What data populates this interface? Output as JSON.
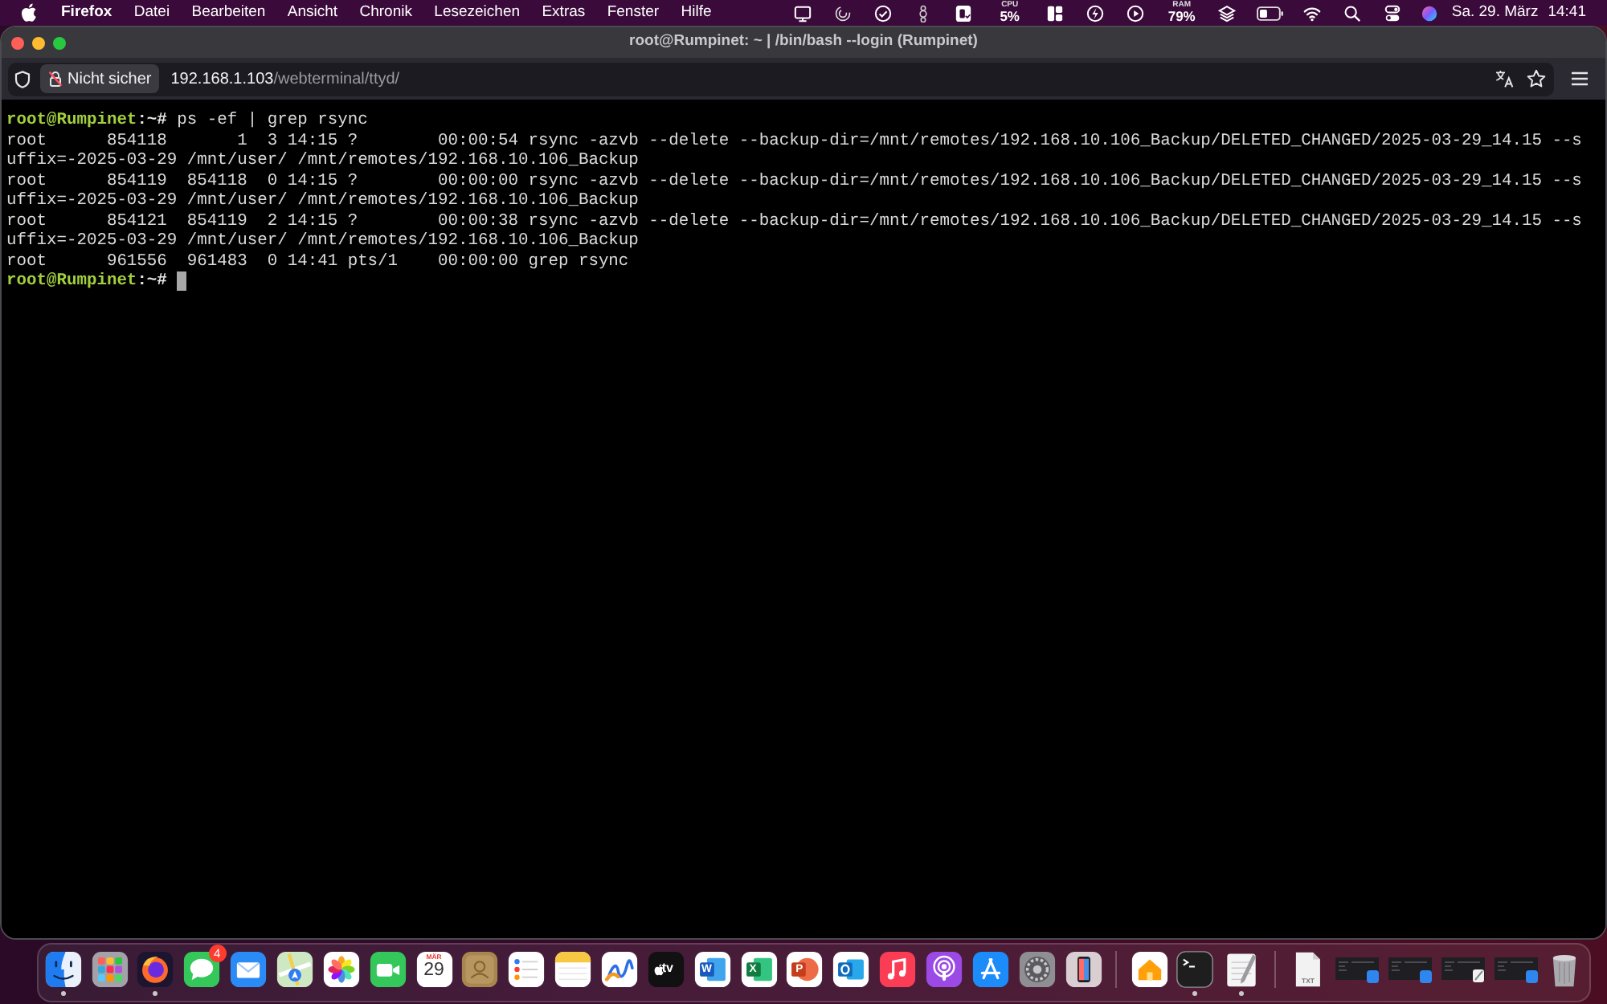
{
  "menubar": {
    "app": "Firefox",
    "menus": [
      "Datei",
      "Bearbeiten",
      "Ansicht",
      "Chronik",
      "Lesezeichen",
      "Extras",
      "Fenster",
      "Hilfe"
    ],
    "status_items": [
      {
        "kind": "screen"
      },
      {
        "kind": "spiral"
      },
      {
        "kind": "check"
      },
      {
        "kind": "figure"
      },
      {
        "kind": "tile"
      },
      {
        "kind": "meter",
        "label": "CPU",
        "value": "5%"
      },
      {
        "kind": "layout"
      },
      {
        "kind": "bolt"
      },
      {
        "kind": "play"
      },
      {
        "kind": "meter",
        "label": "RAM",
        "value": "79%"
      },
      {
        "kind": "layers"
      },
      {
        "kind": "battery"
      },
      {
        "kind": "wifi"
      },
      {
        "kind": "search"
      },
      {
        "kind": "toggles"
      },
      {
        "kind": "orb"
      }
    ],
    "date": "Sa. 29. März",
    "time": "14:41"
  },
  "window": {
    "title": "root@Rumpinet: ~ | /bin/bash --login (Rumpinet)"
  },
  "toolbar": {
    "security_label": "Nicht sicher",
    "url_host": "192.168.1.103",
    "url_path": "/webterminal/ttyd/"
  },
  "terminal": {
    "lines": [
      {
        "kind": "prompt",
        "prompt": "root@Rumpinet",
        "location": ":~#",
        "command": "ps -ef | grep rsync",
        "cursor": false
      },
      {
        "kind": "output",
        "text": "root      854118       1  3 14:15 ?        00:00:54 rsync -azvb --delete --backup-dir=/mnt/remotes/192.168.10.106_Backup/DELETED_CHANGED/2025-03-29_14.15 --s",
        "cursor": false
      },
      {
        "kind": "output",
        "text": "uffix=-2025-03-29 /mnt/user/ /mnt/remotes/192.168.10.106_Backup",
        "cursor": false
      },
      {
        "kind": "output",
        "text": "root      854119  854118  0 14:15 ?        00:00:00 rsync -azvb --delete --backup-dir=/mnt/remotes/192.168.10.106_Backup/DELETED_CHANGED/2025-03-29_14.15 --s",
        "cursor": false
      },
      {
        "kind": "output",
        "text": "uffix=-2025-03-29 /mnt/user/ /mnt/remotes/192.168.10.106_Backup",
        "cursor": false
      },
      {
        "kind": "output",
        "text": "root      854121  854119  2 14:15 ?        00:00:38 rsync -azvb --delete --backup-dir=/mnt/remotes/192.168.10.106_Backup/DELETED_CHANGED/2025-03-29_14.15 --s",
        "cursor": false
      },
      {
        "kind": "output",
        "text": "uffix=-2025-03-29 /mnt/user/ /mnt/remotes/192.168.10.106_Backup",
        "cursor": false
      },
      {
        "kind": "output",
        "text": "root      961556  961483  0 14:41 pts/1    00:00:00 grep rsync",
        "cursor": false
      },
      {
        "kind": "prompt",
        "prompt": "root@Rumpinet",
        "location": ":~#",
        "cursor": true
      }
    ]
  },
  "dock": {
    "apps": [
      {
        "kind": "finder",
        "running": true
      },
      {
        "kind": "launchpad",
        "running": false
      },
      {
        "kind": "firefox",
        "running": true
      },
      {
        "kind": "messages",
        "running": false,
        "badge": "4"
      },
      {
        "kind": "mail",
        "running": false
      },
      {
        "kind": "maps",
        "running": false
      },
      {
        "kind": "photos",
        "running": false
      },
      {
        "kind": "facetime",
        "running": false
      },
      {
        "kind": "calendar",
        "running": false,
        "month": "MÄR",
        "day": "29"
      },
      {
        "kind": "contacts",
        "running": false
      },
      {
        "kind": "reminders",
        "running": false
      },
      {
        "kind": "notes",
        "running": false
      },
      {
        "kind": "freeform",
        "running": false
      },
      {
        "kind": "tv",
        "running": false,
        "glyph": "tv"
      },
      {
        "kind": "word",
        "running": false,
        "glyph": "W"
      },
      {
        "kind": "excel",
        "running": false,
        "glyph": "X"
      },
      {
        "kind": "powerpoint",
        "running": false,
        "glyph": "P"
      },
      {
        "kind": "outlook",
        "running": false
      },
      {
        "kind": "music",
        "running": false
      },
      {
        "kind": "podcasts",
        "running": false
      },
      {
        "kind": "appstore",
        "running": false
      },
      {
        "kind": "settings",
        "running": false
      },
      {
        "kind": "iphone",
        "running": false
      }
    ],
    "pinned": [
      {
        "kind": "home",
        "running": false
      },
      {
        "kind": "terminal",
        "running": true
      },
      {
        "kind": "textedit",
        "running": true
      }
    ],
    "others": [
      {
        "kind": "file",
        "running": false,
        "glyph": "TXT"
      },
      {
        "kind": "window",
        "running": false
      },
      {
        "kind": "window",
        "running": false
      },
      {
        "kind": "notewindow",
        "running": false
      },
      {
        "kind": "window",
        "running": false
      },
      {
        "kind": "trash",
        "running": false
      }
    ]
  }
}
